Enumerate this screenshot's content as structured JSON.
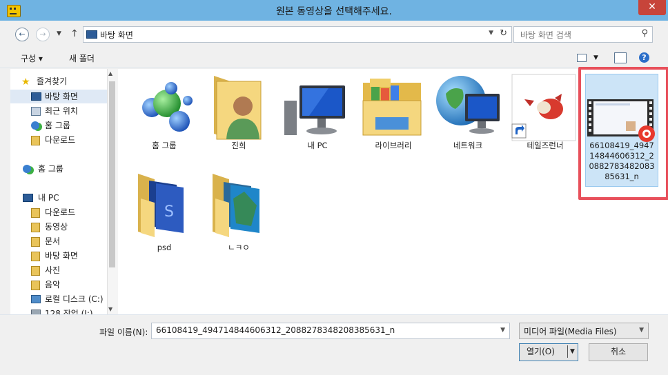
{
  "window": {
    "title": "원본 동영상을 선택해주세요.",
    "close_label": "✕"
  },
  "address": {
    "path": "바탕 화면",
    "search_placeholder": "바탕 화면 검색"
  },
  "toolbar": {
    "organize_label": "구성 ▾",
    "new_folder_label": "새 폴더"
  },
  "sidebar": {
    "favorites_label": "즐겨찾기",
    "favorites": [
      {
        "label": "바탕 화면",
        "icon": "desktop-icon"
      },
      {
        "label": "최근 위치",
        "icon": "recent-places-icon"
      },
      {
        "label": "홈 그룹",
        "icon": "homegroup-icon"
      },
      {
        "label": "다운로드",
        "icon": "downloads-icon"
      }
    ],
    "homegroup_label": "홈 그룹",
    "thispc_label": "내 PC",
    "thispc": [
      {
        "label": "다운로드",
        "icon": "downloads-icon"
      },
      {
        "label": "동영상",
        "icon": "videos-icon"
      },
      {
        "label": "문서",
        "icon": "documents-icon"
      },
      {
        "label": "바탕 화면",
        "icon": "desktop-icon"
      },
      {
        "label": "사진",
        "icon": "pictures-icon"
      },
      {
        "label": "음악",
        "icon": "music-icon"
      },
      {
        "label": "로컬 디스크 (C:)",
        "icon": "drive-icon"
      },
      {
        "label": "128 작업 (I:)",
        "icon": "drive-icon"
      }
    ]
  },
  "files": [
    {
      "label": "홈 그룹",
      "icon": "homegroup-icon"
    },
    {
      "label": "진희",
      "icon": "user-folder-icon"
    },
    {
      "label": "내 PC",
      "icon": "computer-icon"
    },
    {
      "label": "라이브러리",
      "icon": "libraries-icon"
    },
    {
      "label": "네트워크",
      "icon": "network-icon"
    },
    {
      "label": "테일즈런너",
      "icon": "game-shortcut-icon"
    },
    {
      "label": "66108419_494714844606312_2088278348208385631_n",
      "icon": "video-file-icon"
    },
    {
      "label": "psd",
      "icon": "folder-icon"
    },
    {
      "label": "ㄴㅋㅇ",
      "icon": "folder-icon"
    }
  ],
  "bottom": {
    "filename_label": "파일 이름(N):",
    "filename_value": "66108419_494714844606312_2088278348208385631_n",
    "filetype_value": "미디어 파일(Media Files)",
    "open_label": "열기(O)",
    "cancel_label": "취소"
  },
  "colors": {
    "titlebar": "#6fb3e2",
    "close": "#c7443a",
    "highlight_box": "#e8505b",
    "selection": "#cce4f7"
  }
}
